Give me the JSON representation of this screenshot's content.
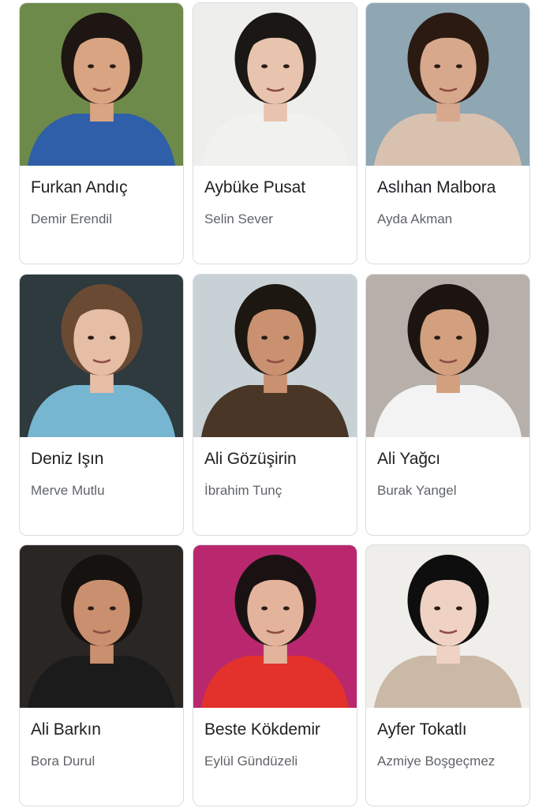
{
  "cast": [
    {
      "name": "Furkan Andıç",
      "role": "Demir Erendil",
      "photo": "man-blue-jacket-park",
      "bg": "#6d8a4a",
      "shirt": "#2f5fa8"
    },
    {
      "name": "Aybüke Pusat",
      "role": "Selin Sever",
      "photo": "woman-curly-hair-white-shirt",
      "bg": "#eeeeec",
      "shirt": "#f1f1f0"
    },
    {
      "name": "Aslıhan Malbora",
      "role": "Ayda Akman",
      "photo": "woman-long-hair-hand-on-chin",
      "bg": "#8fa6b3",
      "shirt": "#d9c1b0"
    },
    {
      "name": "Deniz Işın",
      "role": "Merve Mutlu",
      "photo": "woman-blue-sweater",
      "bg": "#2e3a3d",
      "shirt": "#77b6d0"
    },
    {
      "name": "Ali Gözüşirin",
      "role": "İbrahim Tunç",
      "photo": "man-sunglasses-brown-coat",
      "bg": "#c8d2d6",
      "shirt": "#4a3626"
    },
    {
      "name": "Ali Yağcı",
      "role": "Burak Yangel",
      "photo": "man-white-shirt",
      "bg": "#b7b0aa",
      "shirt": "#f3f3f3"
    },
    {
      "name": "Ali Barkın",
      "role": "Bora Durul",
      "photo": "man-beard-smiling",
      "bg": "#2a2624",
      "shirt": "#1b1b1b"
    },
    {
      "name": "Beste Kökdemir",
      "role": "Eylül Gündüzeli",
      "photo": "woman-red-dress-pink-light",
      "bg": "#b9286e",
      "shirt": "#e3322b"
    },
    {
      "name": "Ayfer Tokatlı",
      "role": "Azmiye Boşgeçmez",
      "photo": "woman-bangs-striped-top",
      "bg": "#efeeeb",
      "shirt": "#c9b9a6"
    }
  ]
}
